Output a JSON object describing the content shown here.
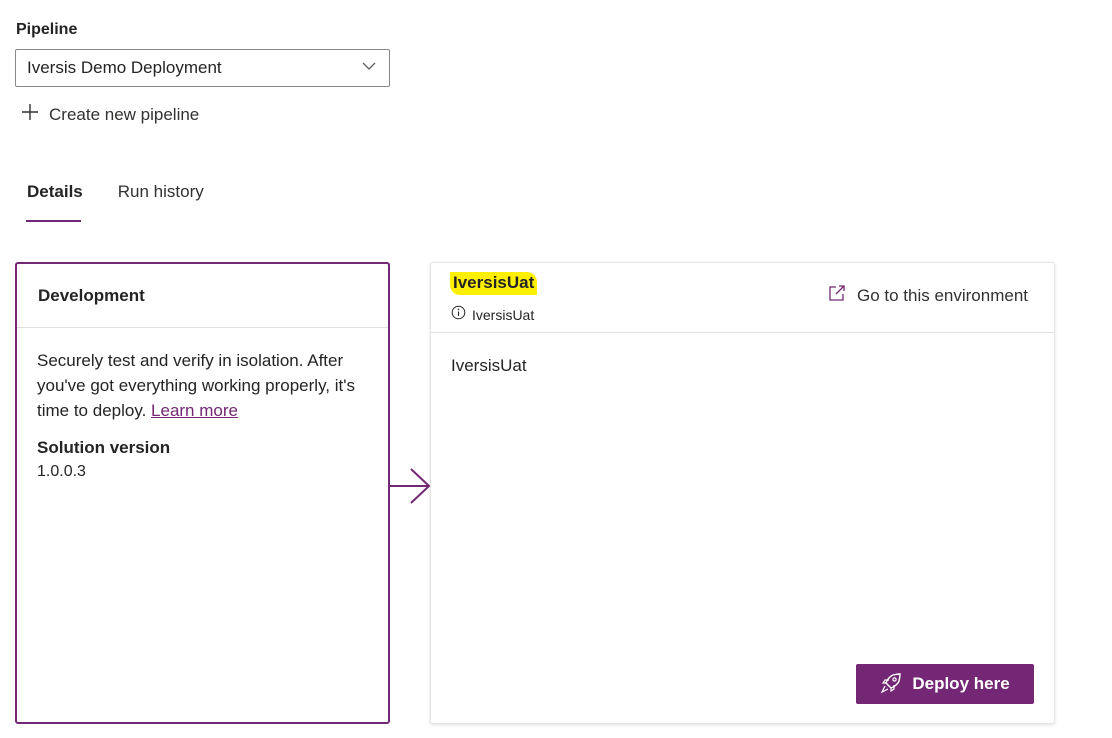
{
  "pipeline": {
    "label": "Pipeline",
    "selected": "Iversis Demo Deployment",
    "create_new_label": "Create new pipeline"
  },
  "tabs": [
    {
      "label": "Details",
      "selected": true
    },
    {
      "label": "Run history",
      "selected": false
    }
  ],
  "development": {
    "title": "Development",
    "description": "Securely test and verify in isolation. After you've got everything working properly, it's time to deploy.",
    "learn_more": "Learn more",
    "solution_version_label": "Solution version",
    "solution_version": "1.0.0.3"
  },
  "target": {
    "title": "IversisUat",
    "subtitle": "IversisUat",
    "go_to_label": "Go to this environment",
    "body": "IversisUat",
    "deploy_label": "Deploy here"
  },
  "colors": {
    "accent": "#742774",
    "highlight": "#ffef00"
  },
  "icons": {
    "dropdown": "chevron-down-icon",
    "create": "plus-icon",
    "info": "info-icon",
    "open": "open-external-icon",
    "deploy": "rocket-icon",
    "connector": "arrow-right-icon"
  }
}
